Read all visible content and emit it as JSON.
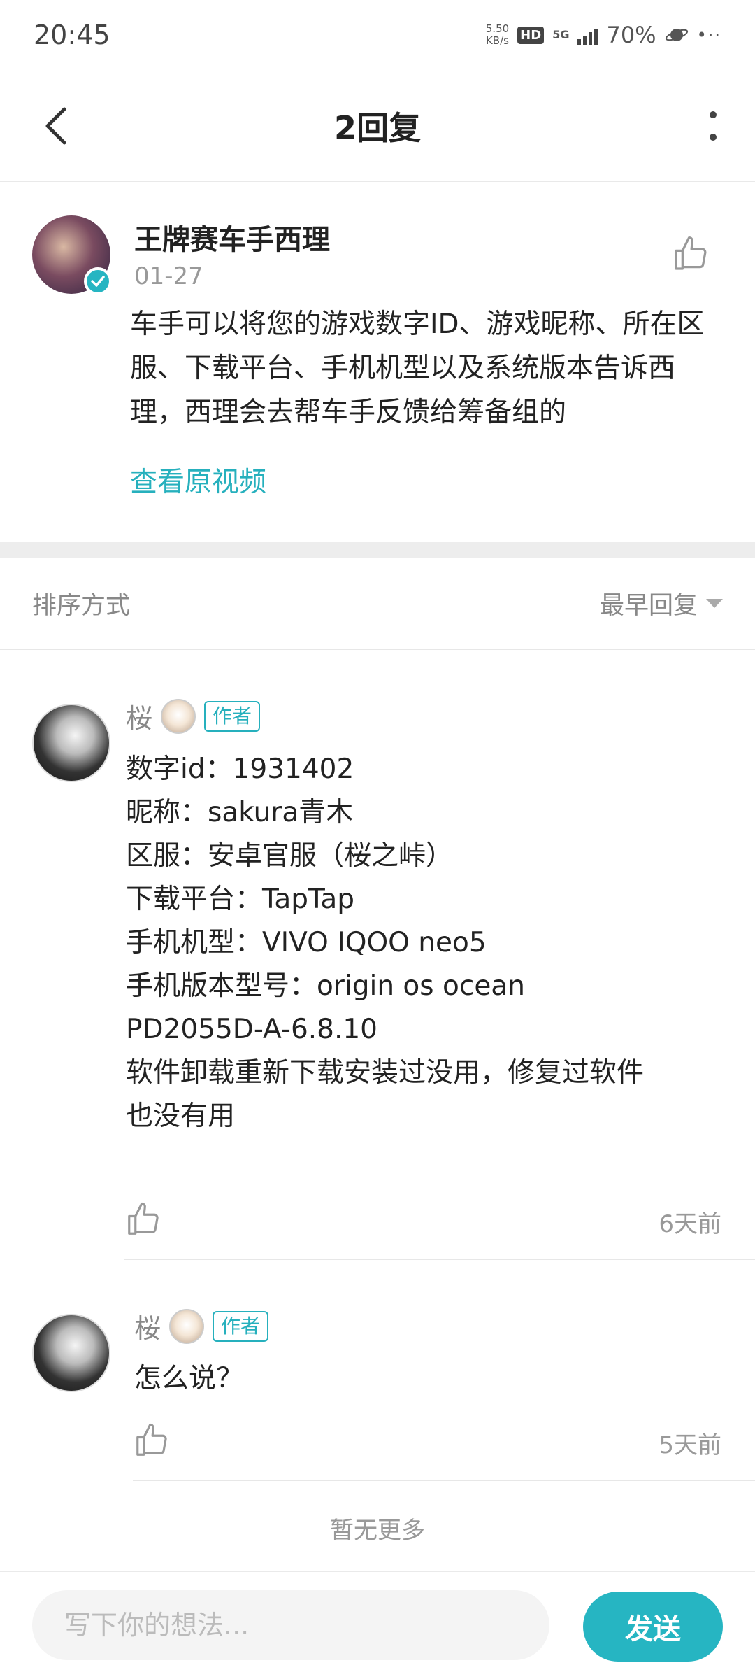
{
  "status_bar": {
    "time": "20:45",
    "net_speed_value": "5.50",
    "net_speed_unit": "KB/s",
    "hd": "HD",
    "network": "5G",
    "battery": "70%"
  },
  "header": {
    "title": "2回复"
  },
  "main_comment": {
    "author": "王牌赛车手西理",
    "date": "01-27",
    "text": "车手可以将您的游戏数字ID、游戏昵称、所在区服、下载平台、手机机型以及系统版本告诉西理，西理会去帮车手反馈给筹备组的",
    "view_video": "查看原视频"
  },
  "sort": {
    "label": "排序方式",
    "value": "最早回复"
  },
  "replies": [
    {
      "author": "桜",
      "badge": "作者",
      "lines": [
        "数字id：1931402",
        "昵称：sakura青木",
        "区服：安卓官服（桜之峠）",
        "下载平台：TapTap",
        "手机机型：VIVO IQOO neo5",
        "手机版本型号：origin os ocean",
        "PD2055D-A-6.8.10",
        "软件卸载重新下载安装过没用，修复过软件",
        "也没有用"
      ],
      "time": "6天前"
    },
    {
      "author": "桜",
      "badge": "作者",
      "lines": [
        "怎么说？"
      ],
      "time": "5天前"
    }
  ],
  "no_more": "暂无更多",
  "input": {
    "placeholder": "写下你的想法...",
    "send": "发送"
  },
  "colors": {
    "accent": "#26b5c2",
    "text": "#222222",
    "muted": "#999999"
  }
}
